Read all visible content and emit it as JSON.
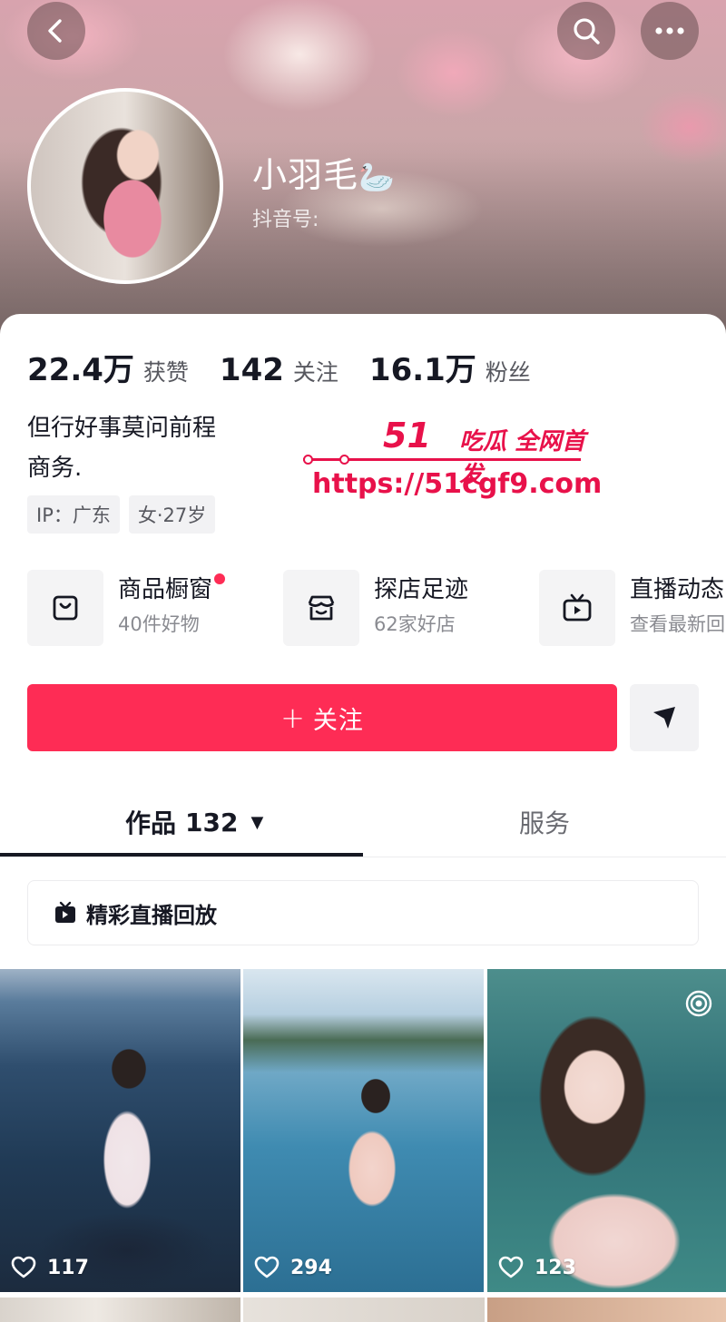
{
  "header": {
    "nickname": "小羽毛",
    "nickname_emoji": "🦢",
    "douyin_id_label": "抖音号:"
  },
  "stats": [
    {
      "value": "22.4万",
      "label": "获赞"
    },
    {
      "value": "142",
      "label": "关注"
    },
    {
      "value": "16.1万",
      "label": "粉丝"
    }
  ],
  "bio": {
    "line1": "但行好事莫问前程",
    "line2": "商务."
  },
  "tags": {
    "ip": "IP：广东",
    "gender_age": "女·27岁"
  },
  "watermark": {
    "brand": "51",
    "brand_text": "吃瓜 全网首发",
    "url": "https://51cgf9.com"
  },
  "features": [
    {
      "title": "商品橱窗",
      "subtitle": "40件好物",
      "icon": "shopping-bag-icon",
      "has_badge": true
    },
    {
      "title": "探店足迹",
      "subtitle": "62家好店",
      "icon": "store-icon",
      "has_badge": false
    },
    {
      "title": "直播动态",
      "subtitle": "查看最新回",
      "icon": "tv-icon",
      "has_badge": false
    }
  ],
  "actions": {
    "follow_label": "关注",
    "follow_plus": "+"
  },
  "tabs": {
    "works_label": "作品",
    "works_count": "132",
    "works_caret": "▼",
    "service_label": "服务"
  },
  "live_replay": {
    "label": "精彩直播回放"
  },
  "videos": [
    {
      "likes": "117"
    },
    {
      "likes": "294"
    },
    {
      "likes": "123"
    }
  ],
  "colors": {
    "accent": "#fe2c55",
    "watermark": "#e8114a",
    "text": "#161823",
    "muted": "#57585f"
  }
}
